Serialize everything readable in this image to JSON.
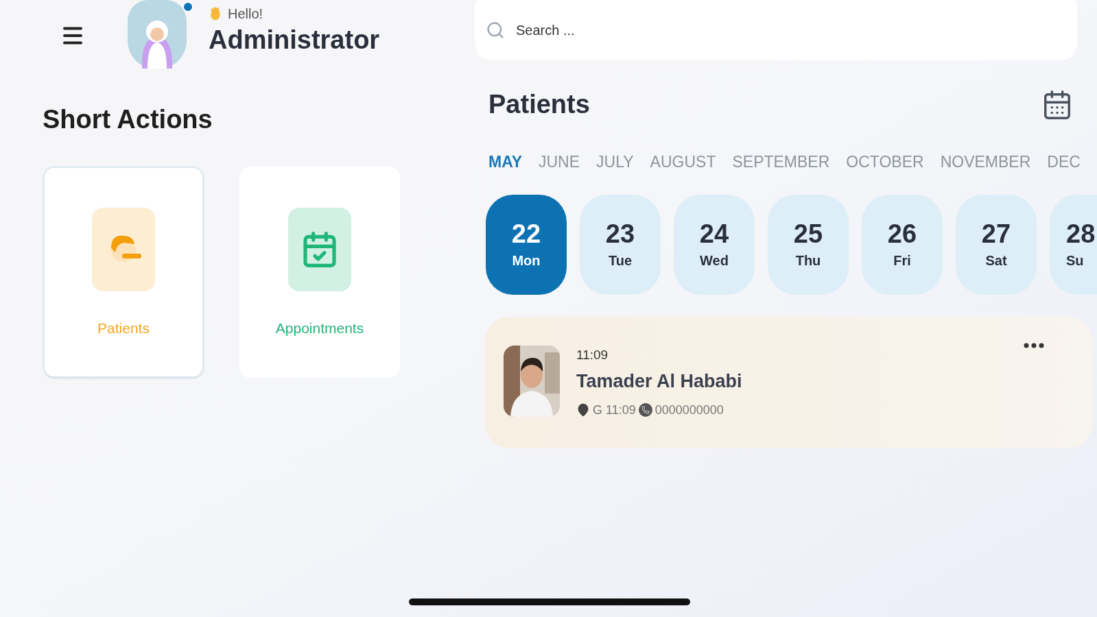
{
  "header": {
    "greeting": "Hello!",
    "user_name": "Administrator",
    "notification": true
  },
  "search": {
    "placeholder": "Search ..."
  },
  "short_actions": {
    "title": "Short Actions",
    "items": [
      {
        "label": "Patients",
        "kind": "patients",
        "selected": true,
        "color": "#f5a623"
      },
      {
        "label": "Appointments",
        "kind": "appointments",
        "selected": false,
        "color": "#1fb67a"
      }
    ]
  },
  "patients": {
    "title": "Patients",
    "months": [
      {
        "label": "MAY",
        "selected": true
      },
      {
        "label": "JUNE",
        "selected": false
      },
      {
        "label": "JULY",
        "selected": false
      },
      {
        "label": "AUGUST",
        "selected": false
      },
      {
        "label": "SEPTEMBER",
        "selected": false
      },
      {
        "label": "OCTOBER",
        "selected": false
      },
      {
        "label": "NOVEMBER",
        "selected": false
      },
      {
        "label": "DEC",
        "selected": false
      }
    ],
    "days": [
      {
        "day": "22",
        "weekday": "Mon",
        "selected": true
      },
      {
        "day": "23",
        "weekday": "Tue",
        "selected": false
      },
      {
        "day": "24",
        "weekday": "Wed",
        "selected": false
      },
      {
        "day": "25",
        "weekday": "Thu",
        "selected": false
      },
      {
        "day": "26",
        "weekday": "Fri",
        "selected": false
      },
      {
        "day": "27",
        "weekday": "Sat",
        "selected": false
      },
      {
        "day": "28",
        "weekday": "Su",
        "selected": false
      }
    ],
    "appointments": [
      {
        "time": "11:09",
        "name": "Tamader Al Hababi",
        "location": "G 11:09",
        "phone": "0000000000"
      }
    ]
  }
}
